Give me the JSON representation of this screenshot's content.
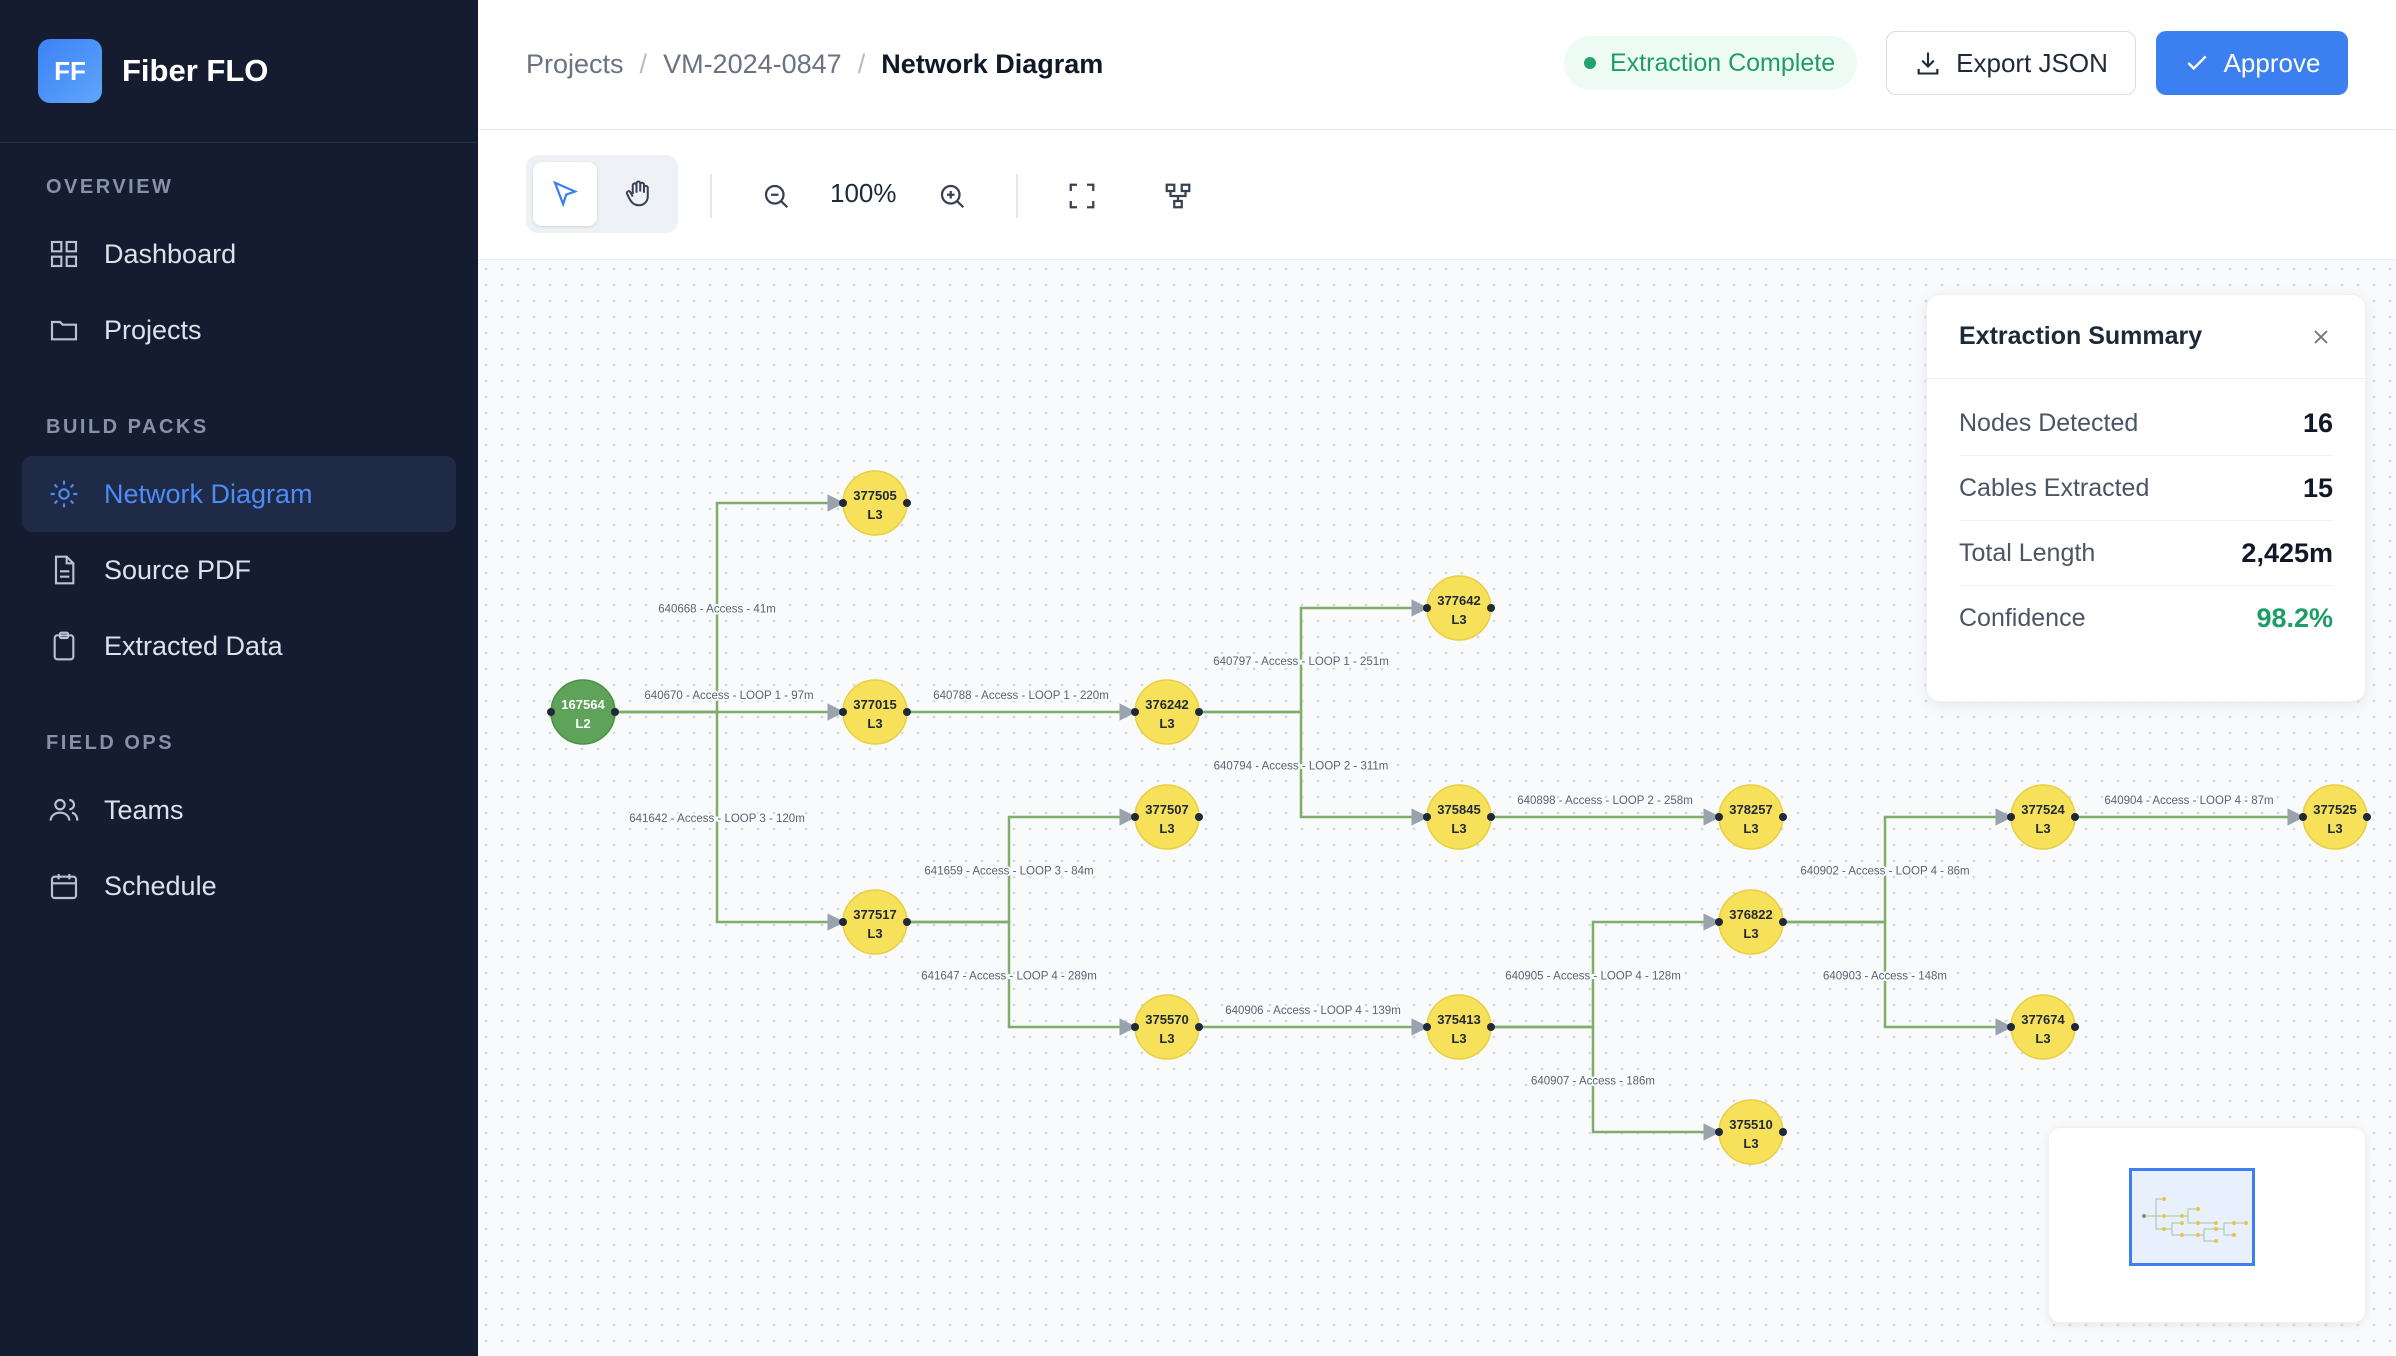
{
  "app": {
    "logo_text": "FF",
    "name": "Fiber FLO"
  },
  "sidebar": {
    "sections": [
      {
        "label": "OVERVIEW",
        "items": [
          {
            "label": "Dashboard",
            "icon": "grid-icon"
          },
          {
            "label": "Projects",
            "icon": "folder-icon"
          }
        ]
      },
      {
        "label": "BUILD PACKS",
        "items": [
          {
            "label": "Network Diagram",
            "icon": "network-icon",
            "active": true
          },
          {
            "label": "Source PDF",
            "icon": "document-icon"
          },
          {
            "label": "Extracted Data",
            "icon": "clipboard-icon"
          }
        ]
      },
      {
        "label": "FIELD OPS",
        "items": [
          {
            "label": "Teams",
            "icon": "users-icon"
          },
          {
            "label": "Schedule",
            "icon": "calendar-icon"
          }
        ]
      }
    ]
  },
  "header": {
    "breadcrumb": [
      "Projects",
      "VM-2024-0847",
      "Network Diagram"
    ],
    "status": "Extraction Complete",
    "export_label": "Export JSON",
    "approve_label": "Approve"
  },
  "toolbar": {
    "zoom": "100%"
  },
  "summary": {
    "title": "Extraction Summary",
    "rows": [
      {
        "label": "Nodes Detected",
        "value": "16"
      },
      {
        "label": "Cables Extracted",
        "value": "15"
      },
      {
        "label": "Total Length",
        "value": "2,425m"
      },
      {
        "label": "Confidence",
        "value": "98.2%"
      }
    ]
  },
  "diagram": {
    "nodes": [
      {
        "id": "167564",
        "level": "L2",
        "color": "#5fa35a"
      },
      {
        "id": "377505",
        "level": "L3"
      },
      {
        "id": "377015",
        "level": "L3"
      },
      {
        "id": "377517",
        "level": "L3"
      },
      {
        "id": "376242",
        "level": "L3"
      },
      {
        "id": "377642",
        "level": "L3"
      },
      {
        "id": "375845",
        "level": "L3"
      },
      {
        "id": "377507",
        "level": "L3"
      },
      {
        "id": "375570",
        "level": "L3"
      },
      {
        "id": "378257",
        "level": "L3"
      },
      {
        "id": "375413",
        "level": "L3"
      },
      {
        "id": "376822",
        "level": "L3"
      },
      {
        "id": "375510",
        "level": "L3"
      },
      {
        "id": "377524",
        "level": "L3"
      },
      {
        "id": "377674",
        "level": "L3"
      },
      {
        "id": "377525",
        "level": "L3"
      }
    ],
    "edges": [
      {
        "from": "167564",
        "to": "377505",
        "label": "640668 - Access - 41m"
      },
      {
        "from": "167564",
        "to": "377015",
        "label": "640670 - Access - LOOP 1 - 97m"
      },
      {
        "from": "167564",
        "to": "377517",
        "label": "641642 - Access - LOOP 3 - 120m"
      },
      {
        "from": "377015",
        "to": "376242",
        "label": "640788 - Access - LOOP 1 - 220m"
      },
      {
        "from": "376242",
        "to": "377642",
        "label": "640797 - Access - LOOP 1 - 251m"
      },
      {
        "from": "376242",
        "to": "375845",
        "label": "640794 - Access - LOOP 2 - 311m"
      },
      {
        "from": "375845",
        "to": "378257",
        "label": "640898 - Access - LOOP 2 - 258m"
      },
      {
        "from": "377517",
        "to": "377507",
        "label": "641659 - Access - LOOP 3 - 84m"
      },
      {
        "from": "377517",
        "to": "375570",
        "label": "641647 - Access - LOOP 4 - 289m"
      },
      {
        "from": "375570",
        "to": "375413",
        "label": "640906 - Access - LOOP 4 - 139m"
      },
      {
        "from": "375413",
        "to": "376822",
        "label": "640905 - Access - LOOP 4 - 128m"
      },
      {
        "from": "375413",
        "to": "375510",
        "label": "640907 - Access - 186m"
      },
      {
        "from": "376822",
        "to": "377524",
        "label": "640902 - Access - LOOP 4 - 86m"
      },
      {
        "from": "376822",
        "to": "377674",
        "label": "640903 - Access - 148m"
      },
      {
        "from": "377524",
        "to": "377525",
        "label": "640904 - Access - LOOP 4 - 87m"
      }
    ]
  },
  "colors": {
    "accent": "#3b7ff0",
    "node_l3": "#f7e15a",
    "edge": "#7fae6b",
    "success": "#1f9d68"
  }
}
